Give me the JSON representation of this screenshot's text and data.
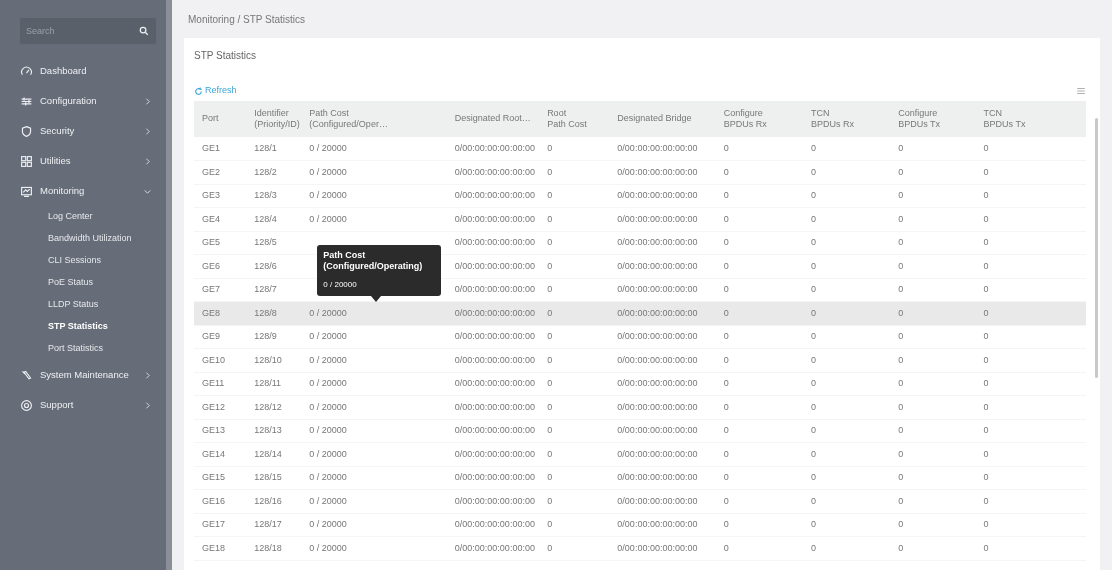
{
  "sidebar": {
    "search": {
      "placeholder": "Search"
    },
    "items": [
      {
        "label": "Dashboard"
      },
      {
        "label": "Configuration",
        "expanded": false
      },
      {
        "label": "Security",
        "expanded": false
      },
      {
        "label": "Utilities",
        "expanded": false
      },
      {
        "label": "Monitoring",
        "expanded": true,
        "children": [
          {
            "label": "Log Center",
            "selected": false
          },
          {
            "label": "Bandwidth Utilization",
            "selected": false
          },
          {
            "label": "CLI Sessions",
            "selected": false
          },
          {
            "label": "PoE Status",
            "selected": false
          },
          {
            "label": "LLDP Status",
            "selected": false
          },
          {
            "label": "STP Statistics",
            "selected": true
          },
          {
            "label": "Port Statistics",
            "selected": false
          }
        ]
      },
      {
        "label": "System Maintenance",
        "expanded": false
      },
      {
        "label": "Support",
        "expanded": false
      }
    ]
  },
  "breadcrumb": "Monitoring / STP Statistics",
  "card": {
    "title": "STP Statistics",
    "refresh": "Refresh",
    "table": {
      "columns": [
        {
          "lines": [
            "Port"
          ]
        },
        {
          "lines": [
            "Identifier",
            "(Priority/ID)"
          ]
        },
        {
          "lines": [
            "Path Cost",
            "(Configured/Oper…"
          ]
        },
        {
          "lines": [
            "Designated Root…"
          ]
        },
        {
          "lines": [
            "Root",
            "Path Cost"
          ]
        },
        {
          "lines": [
            "Designated Bridge"
          ]
        },
        {
          "lines": [
            "Configure",
            "BPDUs Rx"
          ]
        },
        {
          "lines": [
            "TCN",
            "BPDUs Rx"
          ]
        },
        {
          "lines": [
            "Configure",
            "BPDUs Tx"
          ]
        },
        {
          "lines": [
            "TCN",
            "BPDUs Tx"
          ]
        }
      ],
      "rows": [
        {
          "highlighted": false,
          "port": "GE1",
          "identifier": "128/1",
          "path_cost": "0 / 20000",
          "designated_root": "0/00:00:00:00:00:00",
          "root_path_cost": "0",
          "designated_bridge": "0/00:00:00:00:00:00",
          "cfg_rx": "0",
          "tcn_rx": "0",
          "cfg_tx": "0",
          "tcn_tx": "0"
        },
        {
          "highlighted": false,
          "port": "GE2",
          "identifier": "128/2",
          "path_cost": "0 / 20000",
          "designated_root": "0/00:00:00:00:00:00",
          "root_path_cost": "0",
          "designated_bridge": "0/00:00:00:00:00:00",
          "cfg_rx": "0",
          "tcn_rx": "0",
          "cfg_tx": "0",
          "tcn_tx": "0"
        },
        {
          "highlighted": false,
          "port": "GE3",
          "identifier": "128/3",
          "path_cost": "0 / 20000",
          "designated_root": "0/00:00:00:00:00:00",
          "root_path_cost": "0",
          "designated_bridge": "0/00:00:00:00:00:00",
          "cfg_rx": "0",
          "tcn_rx": "0",
          "cfg_tx": "0",
          "tcn_tx": "0"
        },
        {
          "highlighted": false,
          "port": "GE4",
          "identifier": "128/4",
          "path_cost": "0 / 20000",
          "designated_root": "0/00:00:00:00:00:00",
          "root_path_cost": "0",
          "designated_bridge": "0/00:00:00:00:00:00",
          "cfg_rx": "0",
          "tcn_rx": "0",
          "cfg_tx": "0",
          "tcn_tx": "0"
        },
        {
          "highlighted": false,
          "port": "GE5",
          "identifier": "128/5",
          "designated_root": "0/00:00:00:00:00:00",
          "root_path_cost": "0",
          "designated_bridge": "0/00:00:00:00:00:00",
          "cfg_rx": "0",
          "tcn_rx": "0",
          "cfg_tx": "0",
          "tcn_tx": "0"
        },
        {
          "highlighted": false,
          "port": "GE6",
          "identifier": "128/6",
          "designated_root": "0/00:00:00:00:00:00",
          "root_path_cost": "0",
          "designated_bridge": "0/00:00:00:00:00:00",
          "cfg_rx": "0",
          "tcn_rx": "0",
          "cfg_tx": "0",
          "tcn_tx": "0"
        },
        {
          "highlighted": false,
          "port": "GE7",
          "identifier": "128/7",
          "designated_root": "0/00:00:00:00:00:00",
          "root_path_cost": "0",
          "designated_bridge": "0/00:00:00:00:00:00",
          "cfg_rx": "0",
          "tcn_rx": "0",
          "cfg_tx": "0",
          "tcn_tx": "0"
        },
        {
          "highlighted": true,
          "port": "GE8",
          "identifier": "128/8",
          "path_cost": "0 / 20000",
          "designated_root": "0/00:00:00:00:00:00",
          "root_path_cost": "0",
          "designated_bridge": "0/00:00:00:00:00:00",
          "cfg_rx": "0",
          "tcn_rx": "0",
          "cfg_tx": "0",
          "tcn_tx": "0",
          "tooltip": {
            "title": "Path Cost (Configured/Operating)",
            "value": "0 / 20000"
          }
        },
        {
          "highlighted": false,
          "port": "GE9",
          "identifier": "128/9",
          "path_cost": "0 / 20000",
          "designated_root": "0/00:00:00:00:00:00",
          "root_path_cost": "0",
          "designated_bridge": "0/00:00:00:00:00:00",
          "cfg_rx": "0",
          "tcn_rx": "0",
          "cfg_tx": "0",
          "tcn_tx": "0"
        },
        {
          "highlighted": false,
          "port": "GE10",
          "identifier": "128/10",
          "path_cost": "0 / 20000",
          "designated_root": "0/00:00:00:00:00:00",
          "root_path_cost": "0",
          "designated_bridge": "0/00:00:00:00:00:00",
          "cfg_rx": "0",
          "tcn_rx": "0",
          "cfg_tx": "0",
          "tcn_tx": "0"
        },
        {
          "highlighted": false,
          "port": "GE11",
          "identifier": "128/11",
          "path_cost": "0 / 20000",
          "designated_root": "0/00:00:00:00:00:00",
          "root_path_cost": "0",
          "designated_bridge": "0/00:00:00:00:00:00",
          "cfg_rx": "0",
          "tcn_rx": "0",
          "cfg_tx": "0",
          "tcn_tx": "0"
        },
        {
          "highlighted": false,
          "port": "GE12",
          "identifier": "128/12",
          "path_cost": "0 / 20000",
          "designated_root": "0/00:00:00:00:00:00",
          "root_path_cost": "0",
          "designated_bridge": "0/00:00:00:00:00:00",
          "cfg_rx": "0",
          "tcn_rx": "0",
          "cfg_tx": "0",
          "tcn_tx": "0"
        },
        {
          "highlighted": false,
          "port": "GE13",
          "identifier": "128/13",
          "path_cost": "0 / 20000",
          "designated_root": "0/00:00:00:00:00:00",
          "root_path_cost": "0",
          "designated_bridge": "0/00:00:00:00:00:00",
          "cfg_rx": "0",
          "tcn_rx": "0",
          "cfg_tx": "0",
          "tcn_tx": "0"
        },
        {
          "highlighted": false,
          "port": "GE14",
          "identifier": "128/14",
          "path_cost": "0 / 20000",
          "designated_root": "0/00:00:00:00:00:00",
          "root_path_cost": "0",
          "designated_bridge": "0/00:00:00:00:00:00",
          "cfg_rx": "0",
          "tcn_rx": "0",
          "cfg_tx": "0",
          "tcn_tx": "0"
        },
        {
          "highlighted": false,
          "port": "GE15",
          "identifier": "128/15",
          "path_cost": "0 / 20000",
          "designated_root": "0/00:00:00:00:00:00",
          "root_path_cost": "0",
          "designated_bridge": "0/00:00:00:00:00:00",
          "cfg_rx": "0",
          "tcn_rx": "0",
          "cfg_tx": "0",
          "tcn_tx": "0"
        },
        {
          "highlighted": false,
          "port": "GE16",
          "identifier": "128/16",
          "path_cost": "0 / 20000",
          "designated_root": "0/00:00:00:00:00:00",
          "root_path_cost": "0",
          "designated_bridge": "0/00:00:00:00:00:00",
          "cfg_rx": "0",
          "tcn_rx": "0",
          "cfg_tx": "0",
          "tcn_tx": "0"
        },
        {
          "highlighted": false,
          "port": "GE17",
          "identifier": "128/17",
          "path_cost": "0 / 20000",
          "designated_root": "0/00:00:00:00:00:00",
          "root_path_cost": "0",
          "designated_bridge": "0/00:00:00:00:00:00",
          "cfg_rx": "0",
          "tcn_rx": "0",
          "cfg_tx": "0",
          "tcn_tx": "0"
        },
        {
          "highlighted": false,
          "port": "GE18",
          "identifier": "128/18",
          "path_cost": "0 / 20000",
          "designated_root": "0/00:00:00:00:00:00",
          "root_path_cost": "0",
          "designated_bridge": "0/00:00:00:00:00:00",
          "cfg_rx": "0",
          "tcn_rx": "0",
          "cfg_tx": "0",
          "tcn_tx": "0"
        }
      ]
    }
  }
}
